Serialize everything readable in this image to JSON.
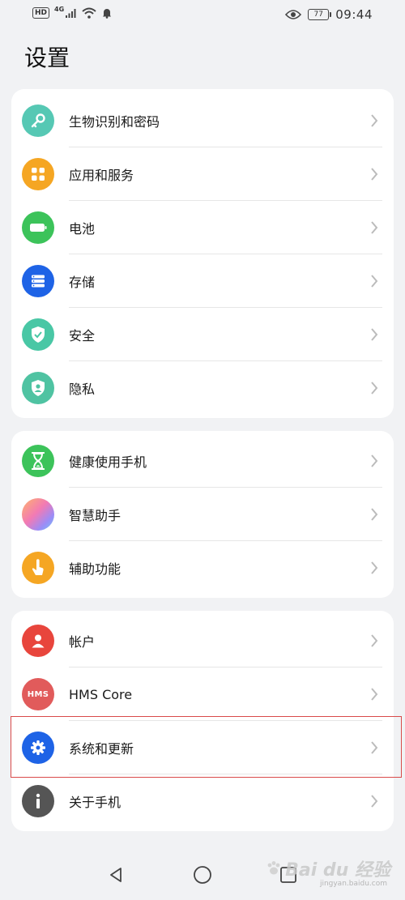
{
  "status": {
    "hd": "HD",
    "network": "4G",
    "battery": "77",
    "time": "09:44"
  },
  "page_title": "设置",
  "groups": [
    {
      "items": [
        {
          "label": "生物识别和密码",
          "icon": "key-icon",
          "color": "#56c8b4"
        },
        {
          "label": "应用和服务",
          "icon": "apps-grid-icon",
          "color": "#f5a623"
        },
        {
          "label": "电池",
          "icon": "battery-icon",
          "color": "#3cc35a"
        },
        {
          "label": "存储",
          "icon": "storage-icon",
          "color": "#1e63e6"
        },
        {
          "label": "安全",
          "icon": "shield-check-icon",
          "color": "#49c7a5"
        },
        {
          "label": "隐私",
          "icon": "privacy-shield-icon",
          "color": "#4fc3a2"
        }
      ]
    },
    {
      "items": [
        {
          "label": "健康使用手机",
          "icon": "hourglass-icon",
          "color": "#3cc35a"
        },
        {
          "label": "智慧助手",
          "icon": "assistant-orb-icon",
          "color": "#c58bf0"
        },
        {
          "label": "辅助功能",
          "icon": "hand-pointer-icon",
          "color": "#f5a623"
        }
      ]
    },
    {
      "items": [
        {
          "label": "帐户",
          "icon": "user-icon",
          "color": "#e8453c"
        },
        {
          "label": "HMS Core",
          "icon": "hms-icon",
          "color": "#e15b5b",
          "icon_text": "HMS"
        },
        {
          "label": "系统和更新",
          "icon": "gear-icon",
          "color": "#1e63e6"
        },
        {
          "label": "关于手机",
          "icon": "info-icon",
          "color": "#555555"
        }
      ]
    }
  ],
  "watermark": {
    "text": "Bai du 经验",
    "sub": "jingyan.baidu.com"
  },
  "highlight_color": "#d94a4a"
}
